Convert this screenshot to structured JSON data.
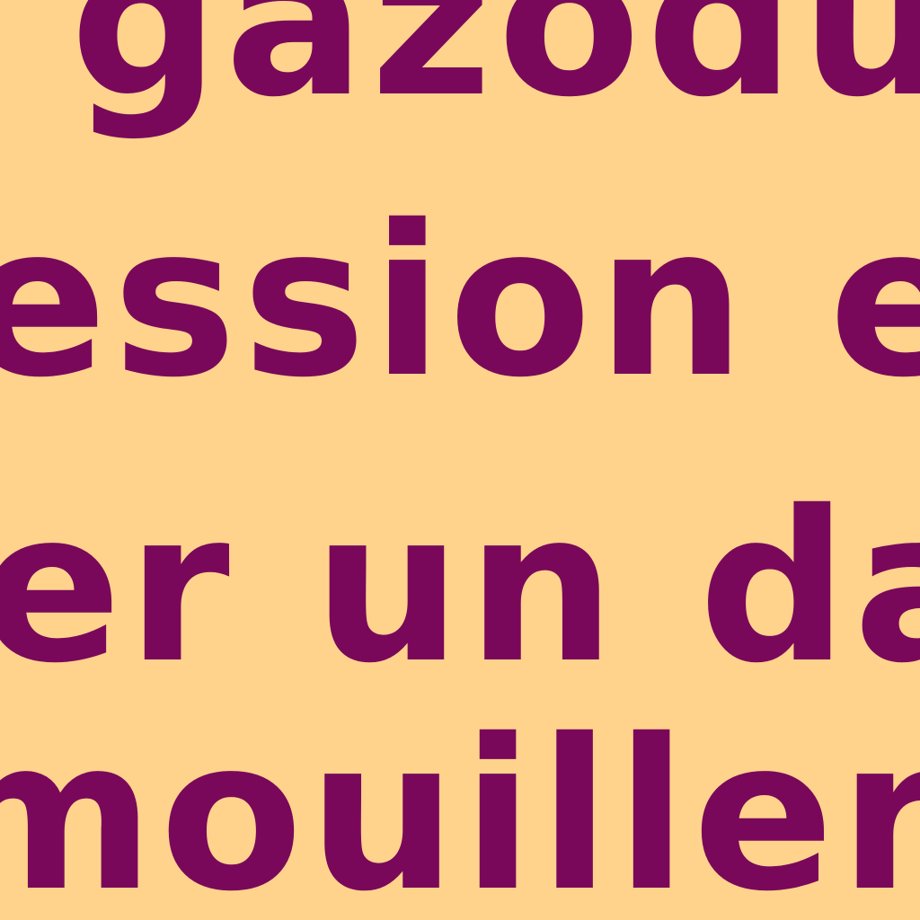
{
  "colors": {
    "background": "#FFD38C",
    "text": "#7A085A"
  },
  "lines": [
    "gazoduc",
    "ession et",
    "er un dan",
    "mouiller"
  ]
}
